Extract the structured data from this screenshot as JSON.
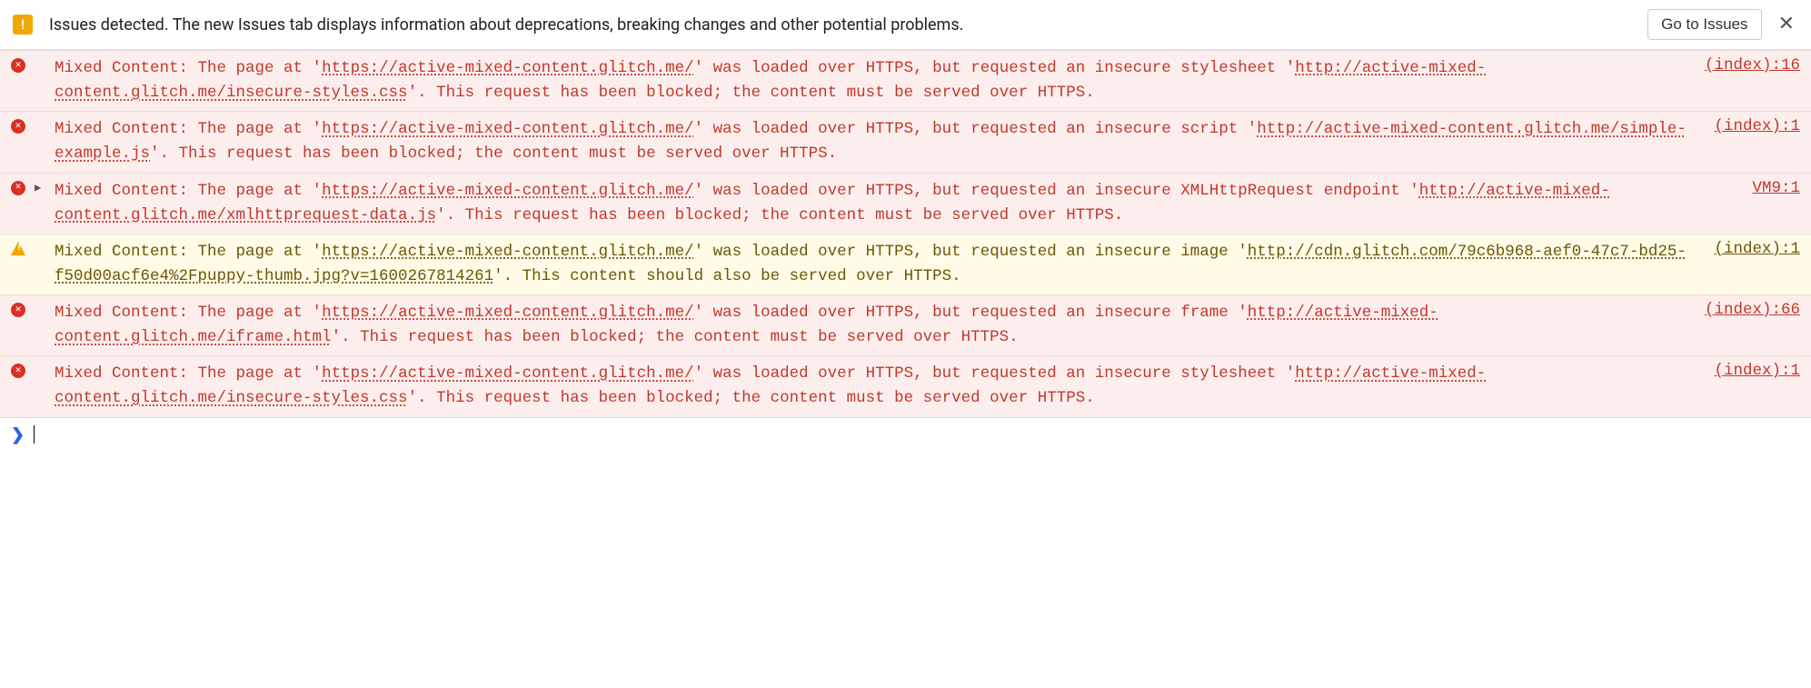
{
  "issuesBar": {
    "text": "Issues detected. The new Issues tab displays information about deprecations, breaking changes and other potential problems.",
    "button": "Go to Issues"
  },
  "pageUrl": "https://active-mixed-content.glitch.me/",
  "rows": [
    {
      "level": "error",
      "expandable": false,
      "source": "(index):16",
      "parts": [
        {
          "t": "text",
          "v": "Mixed Content: The page at '"
        },
        {
          "t": "url",
          "v": "https://active-mixed-content.glitch.me/"
        },
        {
          "t": "text",
          "v": "' was loaded over HTTPS, but requested an insecure stylesheet '"
        },
        {
          "t": "url",
          "v": "http://active-mixed-content.glitch.me/insecure-styles.css"
        },
        {
          "t": "text",
          "v": "'. This request has been blocked; the content must be served over HTTPS."
        }
      ]
    },
    {
      "level": "error",
      "expandable": false,
      "source": "(index):1",
      "parts": [
        {
          "t": "text",
          "v": "Mixed Content: The page at '"
        },
        {
          "t": "url",
          "v": "https://active-mixed-content.glitch.me/"
        },
        {
          "t": "text",
          "v": "' was loaded over HTTPS, but requested an insecure script '"
        },
        {
          "t": "url",
          "v": "http://active-mixed-content.glitch.me/simple-example.js"
        },
        {
          "t": "text",
          "v": "'. This request has been blocked; the content must be served over HTTPS."
        }
      ]
    },
    {
      "level": "error",
      "expandable": true,
      "source": "VM9:1",
      "parts": [
        {
          "t": "text",
          "v": "Mixed Content: The page at '"
        },
        {
          "t": "url",
          "v": "https://active-mixed-content.glitch.me/"
        },
        {
          "t": "text",
          "v": "' was loaded over HTTPS, but requested an insecure XMLHttpRequest endpoint '"
        },
        {
          "t": "url",
          "v": "http://active-mixed-content.glitch.me/xmlhttprequest-data.js"
        },
        {
          "t": "text",
          "v": "'. This request has been blocked; the content must be served over HTTPS."
        }
      ]
    },
    {
      "level": "warn",
      "expandable": false,
      "source": "(index):1",
      "parts": [
        {
          "t": "text",
          "v": "Mixed Content: The page at '"
        },
        {
          "t": "url",
          "v": "https://active-mixed-content.glitch.me/"
        },
        {
          "t": "text",
          "v": "' was loaded over HTTPS, but requested an insecure image '"
        },
        {
          "t": "url",
          "v": "http://cdn.glitch.com/79c6b968-aef0-47c7-bd25-f50d00acf6e4%2Fpuppy-thumb.jpg?v=1600267814261"
        },
        {
          "t": "text",
          "v": "'. This content should also be served over HTTPS."
        }
      ]
    },
    {
      "level": "error",
      "expandable": false,
      "source": "(index):66",
      "parts": [
        {
          "t": "text",
          "v": "Mixed Content: The page at '"
        },
        {
          "t": "url",
          "v": "https://active-mixed-content.glitch.me/"
        },
        {
          "t": "text",
          "v": "' was loaded over HTTPS, but requested an insecure frame '"
        },
        {
          "t": "url",
          "v": "http://active-mixed-content.glitch.me/iframe.html"
        },
        {
          "t": "text",
          "v": "'. This request has been blocked; the content must be served over HTTPS."
        }
      ]
    },
    {
      "level": "error",
      "expandable": false,
      "source": "(index):1",
      "parts": [
        {
          "t": "text",
          "v": "Mixed Content: The page at '"
        },
        {
          "t": "url",
          "v": "https://active-mixed-content.glitch.me/"
        },
        {
          "t": "text",
          "v": "' was loaded over HTTPS, but requested an insecure stylesheet '"
        },
        {
          "t": "url",
          "v": "http://active-mixed-content.glitch.me/insecure-styles.css"
        },
        {
          "t": "text",
          "v": "'. This request has been blocked; the content must be served over HTTPS."
        }
      ]
    }
  ]
}
